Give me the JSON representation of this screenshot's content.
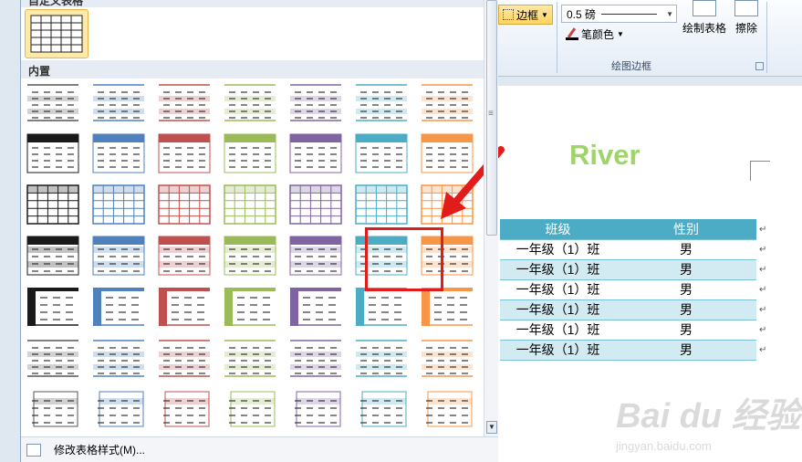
{
  "ribbon": {
    "border_label": "边框",
    "weight_value": "0.5 磅",
    "pen_color_label": "笔颜色",
    "draw_table_label": "绘制表格",
    "erase_label": "擦除",
    "group_label": "绘图边框"
  },
  "gallery": {
    "custom_header": "自定义表格",
    "builtin_header": "内置",
    "footer_label": "修改表格样式(M)...",
    "styles_rows": [
      [
        "plain",
        "blue",
        "red",
        "green",
        "purple",
        "aqua",
        "orange"
      ],
      [
        "black",
        "blue",
        "red",
        "green",
        "purple",
        "aqua",
        "orange"
      ],
      [
        "black",
        "blue",
        "red",
        "green",
        "purple",
        "aqua",
        "orange"
      ],
      [
        "black",
        "blue",
        "red",
        "green",
        "purple",
        "aqua",
        "orange"
      ],
      [
        "black",
        "blue",
        "red",
        "green",
        "purple",
        "aqua",
        "orange"
      ],
      [
        "plain",
        "blue",
        "red",
        "green",
        "purple",
        "aqua",
        "orange"
      ],
      [
        "plain",
        "blue",
        "red",
        "green",
        "purple",
        "aqua",
        "orange"
      ]
    ],
    "selected_style": "row4-col6-aqua"
  },
  "colors": {
    "black": "#1a1a1a",
    "blue": "#4f81bd",
    "red": "#c0504d",
    "green": "#9bbb59",
    "purple": "#8064a2",
    "aqua": "#4bacc6",
    "orange": "#f79646",
    "plain": "#555555",
    "highlight": "#e21b1b"
  },
  "document": {
    "title": "River",
    "table_headers": [
      "班级",
      "性别"
    ],
    "table_rows": [
      [
        "一年级（1）班",
        "男"
      ],
      [
        "一年级（1）班",
        "男"
      ],
      [
        "一年级（1）班",
        "男"
      ],
      [
        "一年级（1）班",
        "男"
      ],
      [
        "一年级（1）班",
        "男"
      ],
      [
        "一年级（1）班",
        "男"
      ]
    ],
    "return_mark": "↵"
  },
  "watermark": {
    "brand": "Bai du 经验",
    "url": "jingyan.baidu.com"
  }
}
